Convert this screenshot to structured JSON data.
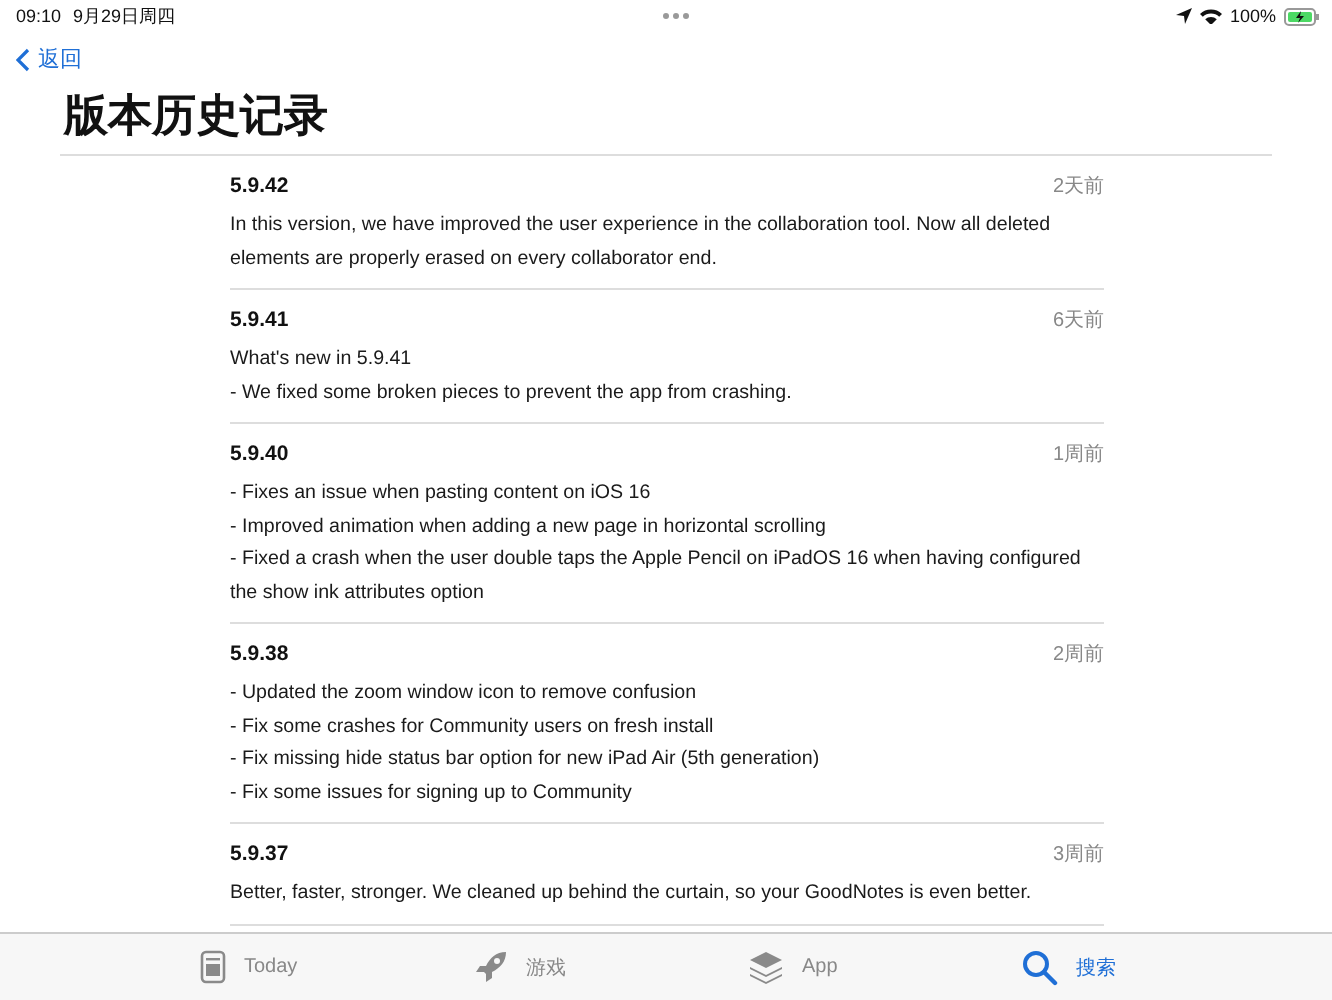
{
  "status_bar": {
    "time": "09:10",
    "date": "9月29日周四",
    "battery": "100%"
  },
  "nav": {
    "back": "返回",
    "title": "版本历史记录"
  },
  "versions": [
    {
      "version": "5.9.42",
      "age": "2天前",
      "notes": [
        "In this version, we have improved the user experience in the collaboration tool. Now all deleted elements are properly erased on every collaborator end."
      ]
    },
    {
      "version": "5.9.41",
      "age": "6天前",
      "notes": [
        "What's new in 5.9.41",
        "- We fixed some broken pieces to prevent the app from crashing."
      ]
    },
    {
      "version": "5.9.40",
      "age": "1周前",
      "notes": [
        "- Fixes an issue when pasting content on iOS 16",
        "- Improved animation when adding a new page in horizontal scrolling",
        "- Fixed a crash when the user double taps the Apple Pencil on iPadOS 16 when having configured the show ink attributes option"
      ]
    },
    {
      "version": "5.9.38",
      "age": "2周前",
      "notes": [
        "- Updated the zoom window icon to remove confusion",
        "- Fix some crashes for Community users on fresh install",
        "- Fix missing hide status bar option for new iPad Air (5th generation)",
        "- Fix some issues for signing up to Community"
      ]
    },
    {
      "version": "5.9.37",
      "age": "3周前",
      "notes": [
        "Better, faster, stronger. We cleaned up behind the curtain, so your GoodNotes is even better."
      ]
    }
  ],
  "tab_bar": [
    {
      "kind": "today",
      "label": "Today",
      "selected": false
    },
    {
      "kind": "games",
      "label": "游戏",
      "selected": false
    },
    {
      "kind": "apps",
      "label": "App",
      "selected": false
    },
    {
      "kind": "search",
      "label": "搜索",
      "selected": true
    }
  ]
}
